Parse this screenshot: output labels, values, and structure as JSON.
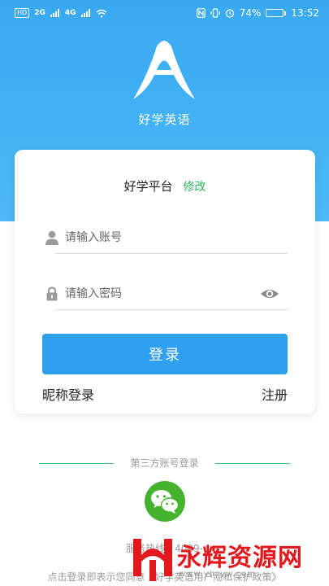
{
  "status_bar": {
    "left_tags": [
      "HD",
      "2G",
      "4G"
    ],
    "battery_percent": "74%",
    "time": "13:52",
    "battery_level": 0.74
  },
  "app": {
    "name": "好学英语"
  },
  "login": {
    "platform_name": "好学平台",
    "platform_edit": "修改",
    "account_placeholder": "请输入账号",
    "password_placeholder": "请输入密码",
    "login_button": "登录",
    "nickname_login": "昵称登录",
    "register": "注册"
  },
  "third_party": {
    "title": "第三方账号登录"
  },
  "footer": {
    "hotline": "服务热线：4009-",
    "agreement": "点击登录即表示您同意《好学英语用户隐私保护政策》"
  },
  "watermark": {
    "text": "永辉资源网",
    "url": "www.yhzyw.com"
  },
  "colors": {
    "primary": "#2f9ff0",
    "accent_green": "#27b35a",
    "wechat": "#46b32f",
    "watermark": "#e2181d"
  }
}
